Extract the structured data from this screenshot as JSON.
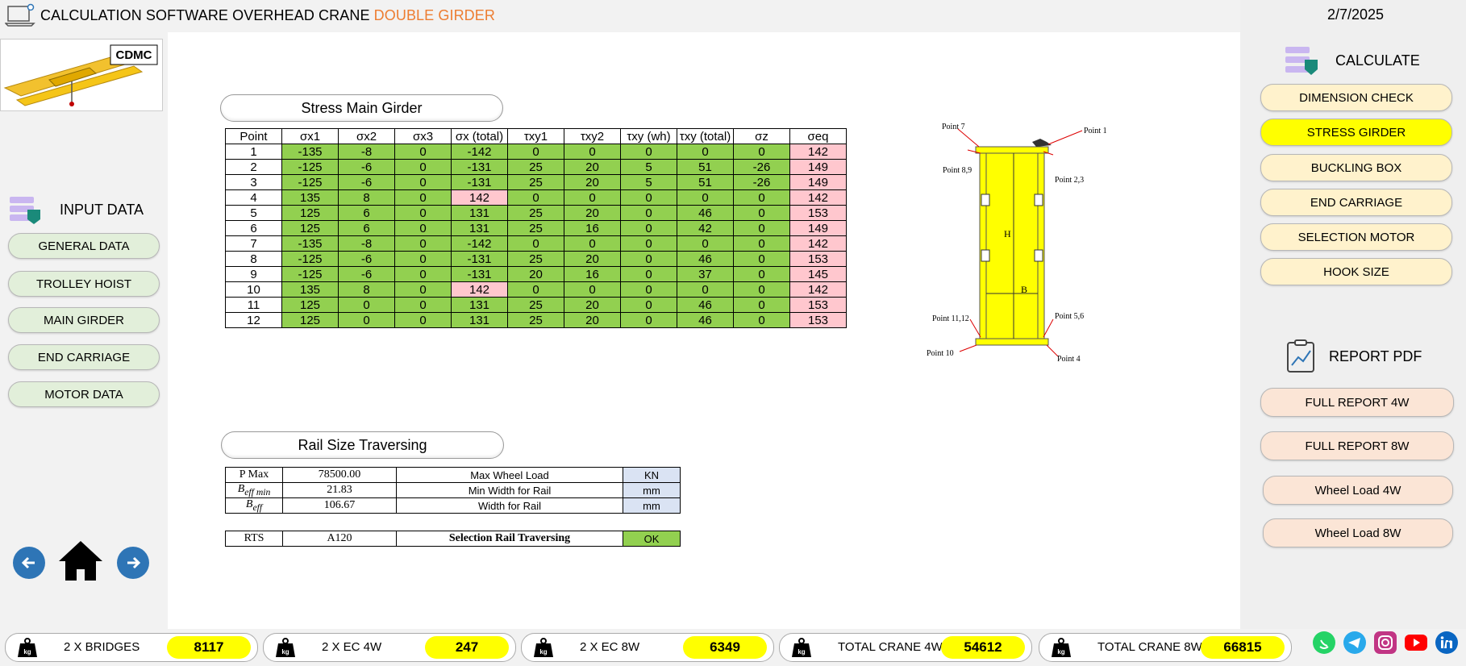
{
  "header": {
    "title": "CALCULATION SOFTWARE OVERHEAD CRANE ",
    "title_accent": "DOUBLE GIRDER",
    "date": "2/7/2025"
  },
  "logo_text": "CDMC",
  "input_panel": {
    "heading": "INPUT DATA",
    "buttons": [
      "GENERAL DATA",
      "TROLLEY HOIST",
      "MAIN GIRDER",
      "END CARRIAGE",
      "MOTOR DATA"
    ]
  },
  "calculate_panel": {
    "heading": "CALCULATE",
    "buttons": [
      "DIMENSION CHECK",
      "STRESS GIRDER",
      "BUCKLING BOX",
      "END CARRIAGE",
      "SELECTION MOTOR",
      "HOOK SIZE"
    ],
    "active": "STRESS GIRDER"
  },
  "report_panel": {
    "heading": "REPORT PDF",
    "buttons": [
      "FULL REPORT 4W",
      "FULL REPORT 8W",
      "Wheel Load 4W",
      "Wheel Load  8W"
    ]
  },
  "stress_table": {
    "title": "Stress Main Girder",
    "headers": [
      "Point",
      "σx1",
      "σx2",
      "σx3",
      "σx (total)",
      "τxy1",
      "τxy2",
      "τxy (wh)",
      "τxy (total)",
      "σz",
      "σeq"
    ],
    "rows": [
      [
        "1",
        "-135",
        "-8",
        "0",
        "-142",
        "0",
        "0",
        "0",
        "0",
        "0",
        "142"
      ],
      [
        "2",
        "-125",
        "-6",
        "0",
        "-131",
        "25",
        "20",
        "5",
        "51",
        "-26",
        "149"
      ],
      [
        "3",
        "-125",
        "-6",
        "0",
        "-131",
        "25",
        "20",
        "5",
        "51",
        "-26",
        "149"
      ],
      [
        "4",
        "135",
        "8",
        "0",
        "142",
        "0",
        "0",
        "0",
        "0",
        "0",
        "142"
      ],
      [
        "5",
        "125",
        "6",
        "0",
        "131",
        "25",
        "20",
        "0",
        "46",
        "0",
        "153"
      ],
      [
        "6",
        "125",
        "6",
        "0",
        "131",
        "25",
        "16",
        "0",
        "42",
        "0",
        "149"
      ],
      [
        "7",
        "-135",
        "-8",
        "0",
        "-142",
        "0",
        "0",
        "0",
        "0",
        "0",
        "142"
      ],
      [
        "8",
        "-125",
        "-6",
        "0",
        "-131",
        "25",
        "20",
        "0",
        "46",
        "0",
        "153"
      ],
      [
        "9",
        "-125",
        "-6",
        "0",
        "-131",
        "20",
        "16",
        "0",
        "37",
        "0",
        "145"
      ],
      [
        "10",
        "135",
        "8",
        "0",
        "142",
        "0",
        "0",
        "0",
        "0",
        "0",
        "142"
      ],
      [
        "11",
        "125",
        "0",
        "0",
        "131",
        "25",
        "20",
        "0",
        "46",
        "0",
        "153"
      ],
      [
        "12",
        "125",
        "0",
        "0",
        "131",
        "25",
        "20",
        "0",
        "46",
        "0",
        "153"
      ]
    ],
    "highlight_sx_total_rows": [
      3,
      9
    ]
  },
  "diagram": {
    "labels": {
      "p7": "Point 7",
      "p1": "Point 1",
      "p89": "Point 8,9",
      "p23": "Point 2,3",
      "h": "H",
      "b": "B",
      "p1112": "Point 11,12",
      "p56": "Point 5,6",
      "p10": "Point 10",
      "p4": "Point 4"
    }
  },
  "rail_table": {
    "title": "Rail Size Traversing",
    "rows": [
      {
        "sym": "P Max",
        "value": "78500.00",
        "desc": "Max Wheel Load",
        "unit": "KN"
      },
      {
        "sym": "B",
        "sub": "eff min",
        "value": "21.83",
        "desc": "Min Width for Rail",
        "unit": "mm"
      },
      {
        "sym": "B",
        "sub": "eff",
        "value": "106.67",
        "desc": "Width for Rail",
        "unit": "mm"
      }
    ],
    "rts": {
      "sym": "RTS",
      "value": "A120",
      "desc": "Selection Rail Traversing",
      "status": "OK"
    }
  },
  "weights": [
    {
      "unit": "kg",
      "label": "2 X BRIDGES",
      "value": "8117"
    },
    {
      "unit": "kg",
      "label": "2 X EC 4W",
      "value": "247"
    },
    {
      "unit": "kg",
      "label": "2 X EC 8W",
      "value": "6349"
    },
    {
      "unit": "kg",
      "label": "TOTAL CRANE 4W",
      "value": "54612"
    },
    {
      "unit": "kg",
      "label": "TOTAL CRANE 8W",
      "value": "66815"
    }
  ],
  "social_icons": [
    "whatsapp-icon",
    "telegram-icon",
    "instagram-icon",
    "youtube-icon",
    "linkedin-icon"
  ],
  "colors": {
    "accent": "#ed7d31",
    "ok_green": "#92d050",
    "warn_pink": "#ffc7ce",
    "active_yellow": "#ffff00",
    "nav_blue": "#2e75b6"
  }
}
